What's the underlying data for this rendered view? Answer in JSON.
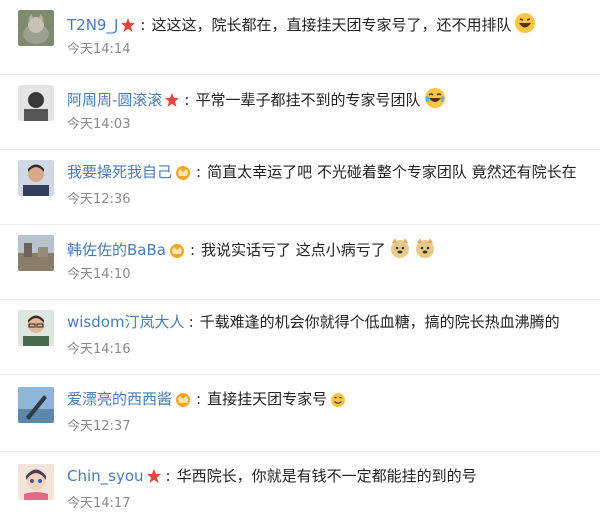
{
  "comments": [
    {
      "user": "T2N9_J",
      "badge": "star-badge-icon",
      "text": "这这这，院长都在，直接挂天团专家号了，还不用排队",
      "emoji": "grinning-face-icon",
      "time": "今天14:14"
    },
    {
      "user": "阿周周-圆滚滚",
      "badge": "star-badge-icon",
      "text": "平常一辈子都挂不到的专家号团队",
      "emoji": "tears-of-joy-icon",
      "time": "今天14:03"
    },
    {
      "user": "我要操死我自己",
      "badge": "crown-badge-icon",
      "text": "简直太幸运了吧 不光碰着整个专家团队 竟然还有院长在",
      "emoji": "",
      "time": "今天12:36"
    },
    {
      "user": "韩佐佐的BaBa",
      "badge": "crown-badge-icon",
      "text": "我说实话亏了 这点小病亏了",
      "emoji": "doge-icon",
      "time": "今天14:10"
    },
    {
      "user": "wisdom汀岚大人",
      "badge": "",
      "text": "千载难逢的机会你就得个低血糖，搞的院长热血沸腾的",
      "emoji": "",
      "time": "今天14:16"
    },
    {
      "user": "爱漂亮的西西酱",
      "badge": "crown-badge-icon",
      "text": "直接挂天团专家号",
      "emoji": "smile-face-icon",
      "time": "今天12:37"
    },
    {
      "user": "Chin_syou",
      "badge": "star-badge-icon",
      "text": "华西院长，你就是有钱不一定都能挂的到的号",
      "emoji": "",
      "time": "今天14:17"
    }
  ],
  "colors": {
    "username": "#4a7bb5",
    "text": "#222222",
    "time": "#8a8a8a",
    "badge_star": "#e8453c",
    "badge_crown": "#f5a623"
  }
}
